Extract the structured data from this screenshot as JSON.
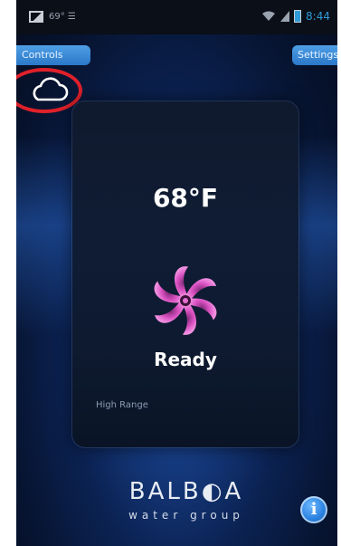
{
  "statusbar": {
    "left_text": "69° ☰",
    "time": "8:44",
    "icons": [
      "screenshot-icon",
      "wifi-icon",
      "signal-icon",
      "battery-icon"
    ]
  },
  "header": {
    "left_tab_label": "Controls",
    "right_tab_label": "Settings"
  },
  "cloud_button": {
    "icon": "cloud-icon"
  },
  "card": {
    "temperature": "68°F",
    "status": "Ready",
    "range": "High Range",
    "heater_icon": "pinwheel-icon"
  },
  "footer": {
    "logo_main": "BALB◐A",
    "logo_sub": "water group",
    "info_icon": "info-icon",
    "info_label": "i"
  },
  "colors": {
    "accent": "#2a78c8",
    "highlight": "#e0202a",
    "pinwheel": "#d94fc0"
  }
}
